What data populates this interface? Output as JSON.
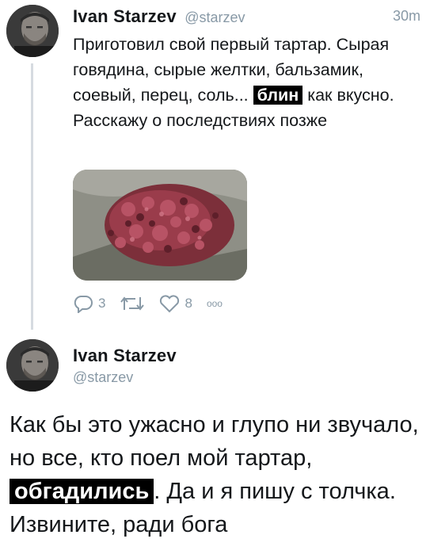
{
  "tweet1": {
    "author_name": "Ivan Starzev",
    "handle": "@starzev",
    "time": "30m",
    "text_before": "Приготовил свой первый тартар. Сырая говядина, сырые желтки, бальзамик, соевый, перец, соль... ",
    "censored_word": "блин",
    "text_after": " как вкусно. Расскажу о последствиях позже",
    "image_icon": "raw-beef-tartare-photo",
    "actions": {
      "reply_icon": "reply-icon",
      "reply_count": "3",
      "retweet_icon": "retweet-icon",
      "like_icon": "heart-icon",
      "like_count": "8",
      "more_icon": "more-dots-icon",
      "more_label": "ooo"
    }
  },
  "tweet2": {
    "author_name": "Ivan Starzev",
    "handle": "@starzev",
    "text_before": "Как бы это ужасно и глупо ни звучало, но все, кто поел мой тартар, ",
    "censored_word": "обгадились",
    "text_after": ". Да и я пишу с толчка. Извините, ради бога"
  },
  "colors": {
    "text": "#14171a",
    "muted": "#8899a6",
    "thread_line": "#d6dbe0",
    "censor_bg": "#000000"
  }
}
